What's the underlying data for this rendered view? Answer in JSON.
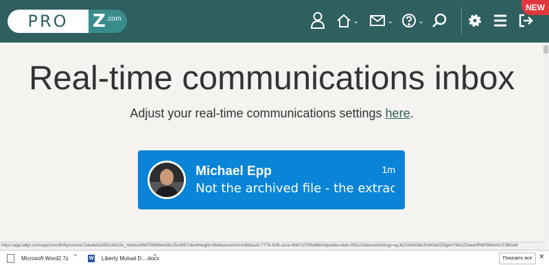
{
  "header": {
    "logo_left": "PRO",
    "logo_z": "Z",
    "logo_com": ".com",
    "new_badge": "NEW"
  },
  "nav": {
    "chevron": "⌄"
  },
  "main": {
    "title": "Real-time communications inbox",
    "subtitle_prefix": "Adjust your real-time communications settings ",
    "subtitle_link": "here",
    "subtitle_suffix": "."
  },
  "conversation": {
    "name": "Michael Epp",
    "time": "1m",
    "message": "Not the archived file - the extrac..."
  },
  "status_url": "https://app.talkjs.com/app/1rwU6V9y/user/dc7a6a4eb16551c8e22e_n/inbox/99d708d56e436c25e365?clientHeight=564&sessionId=b3b5ace0-7778-41f8-a1ee-6bb7c0796c88thirdparties=&id=2061226&localSettings=eyJkZXNrdG9wTm90aWZ5IjpmYWxzZSwiaHRtbFBhbmVsT3B0aW",
  "downloads": {
    "item1": "Microsoft Word2.7z",
    "item2": "Liberty Mutual D....docx",
    "show_all": "Показать все",
    "close": "✕",
    "caret": "^"
  },
  "colors": {
    "header_bg": "#2f5f5f",
    "card_bg": "#0a84d6",
    "badge_bg": "#e0383c"
  }
}
